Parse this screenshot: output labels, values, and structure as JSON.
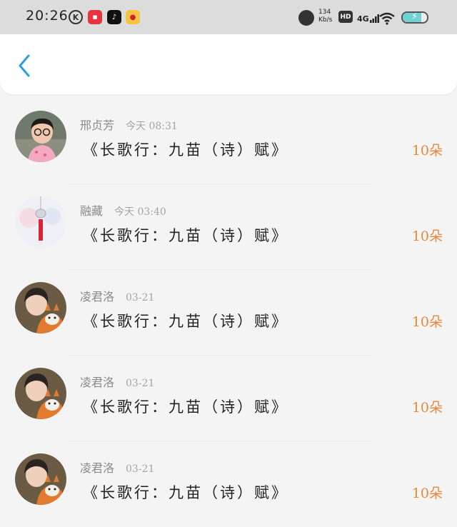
{
  "status_bar": {
    "time": "20:26",
    "speed_value": "134",
    "speed_unit": "Kb/s",
    "hd_label": "HD",
    "network_label": "4G",
    "battery_level": 0.75,
    "app_icons": [
      "k-icon",
      "red-app-icon",
      "tiktok-icon",
      "weibo-icon"
    ]
  },
  "header": {
    "back_icon": "chevron-left-icon"
  },
  "colors": {
    "accent_blue": "#2a9fe8",
    "gift_orange": "#e58a3a",
    "name_gray": "#8a8a8a"
  },
  "rows": [
    {
      "name": "邢贞芳",
      "time": "今天 08:31",
      "title": "《长歌行：九苗（诗）赋》",
      "gift": "10朵"
    },
    {
      "name": "融藏",
      "time": "今天 03:40",
      "title": "《长歌行：九苗（诗）赋》",
      "gift": "10朵"
    },
    {
      "name": "凌君洛",
      "time": "03-21",
      "title": "《长歌行：九苗（诗）赋》",
      "gift": "10朵"
    },
    {
      "name": "凌君洛",
      "time": "03-21",
      "title": "《长歌行：九苗（诗）赋》",
      "gift": "10朵"
    },
    {
      "name": "凌君洛",
      "time": "03-21",
      "title": "《长歌行：九苗（诗）赋》",
      "gift": "10朵"
    }
  ]
}
